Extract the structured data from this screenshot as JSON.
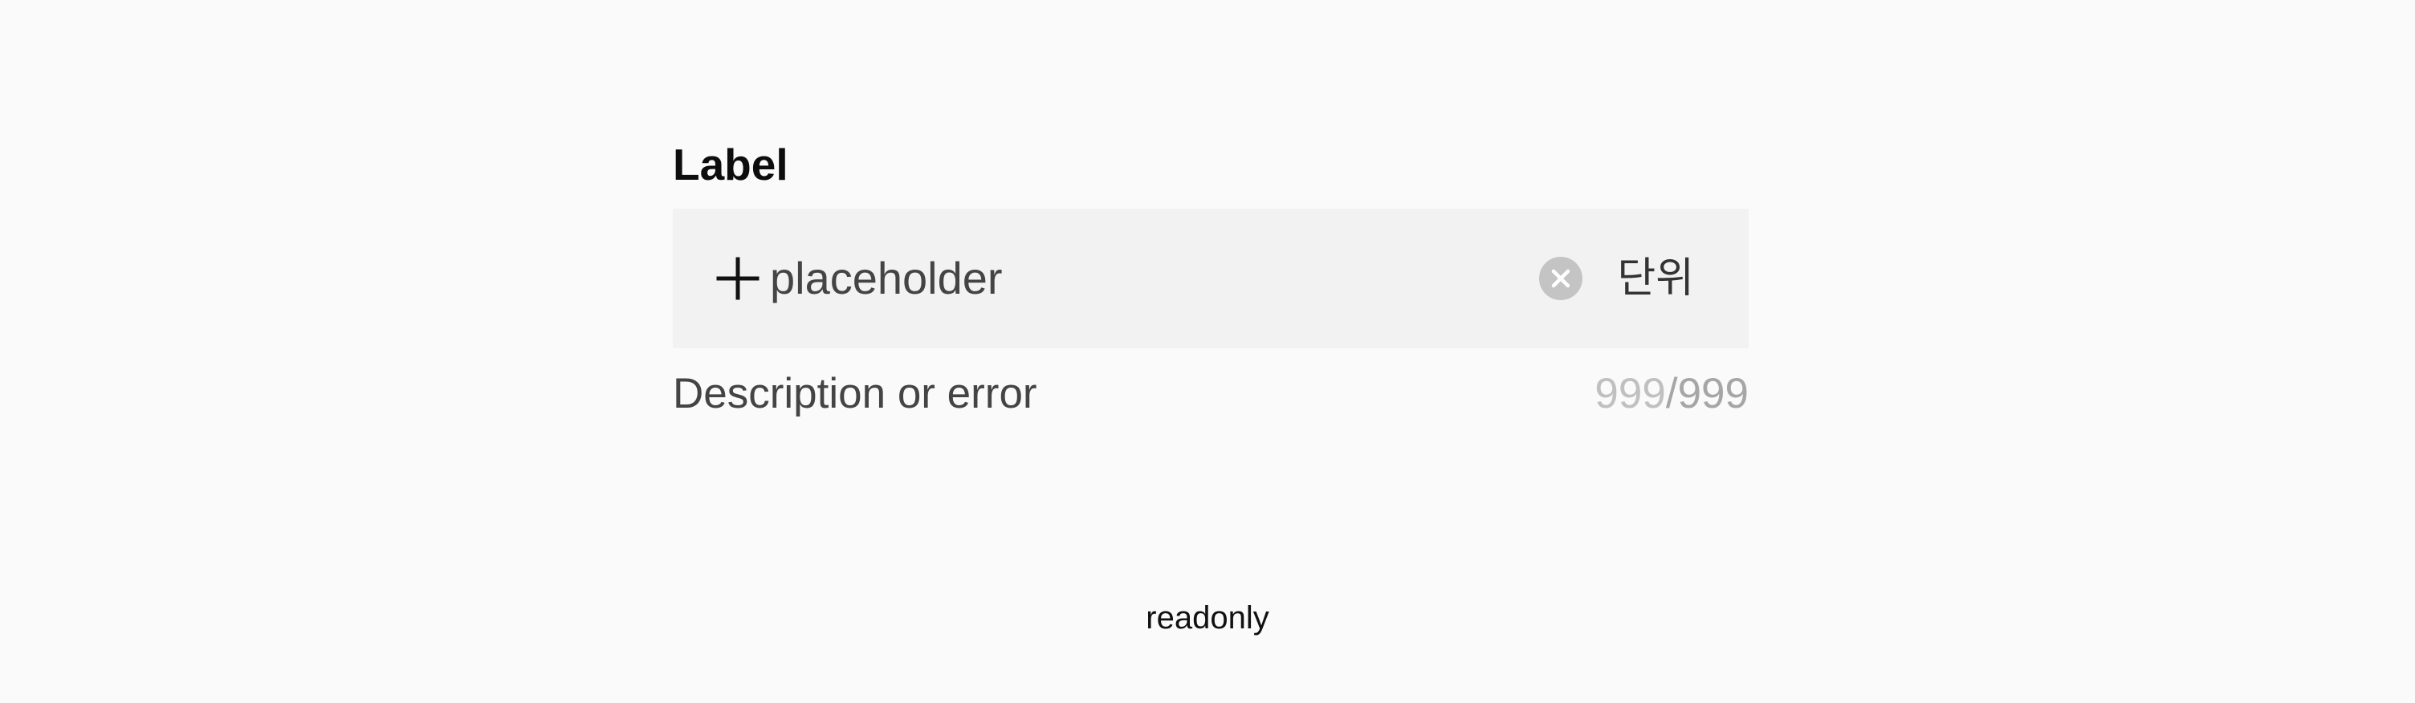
{
  "field": {
    "label": "Label",
    "input": {
      "value": "",
      "placeholder": "placeholder"
    },
    "leading_icon": "plus-icon",
    "trailing_icon": "clear-icon",
    "unit": "단위",
    "description": "Description or error",
    "counter": {
      "current": "999",
      "separator": "/",
      "max": "999"
    }
  },
  "state_caption": "readonly",
  "colors": {
    "background": "#fafafa",
    "input_background": "#f2f2f2",
    "clear_icon": "#c4c4c4",
    "counter_current": "#c0c0c0",
    "counter_max": "#a6a6a6"
  }
}
